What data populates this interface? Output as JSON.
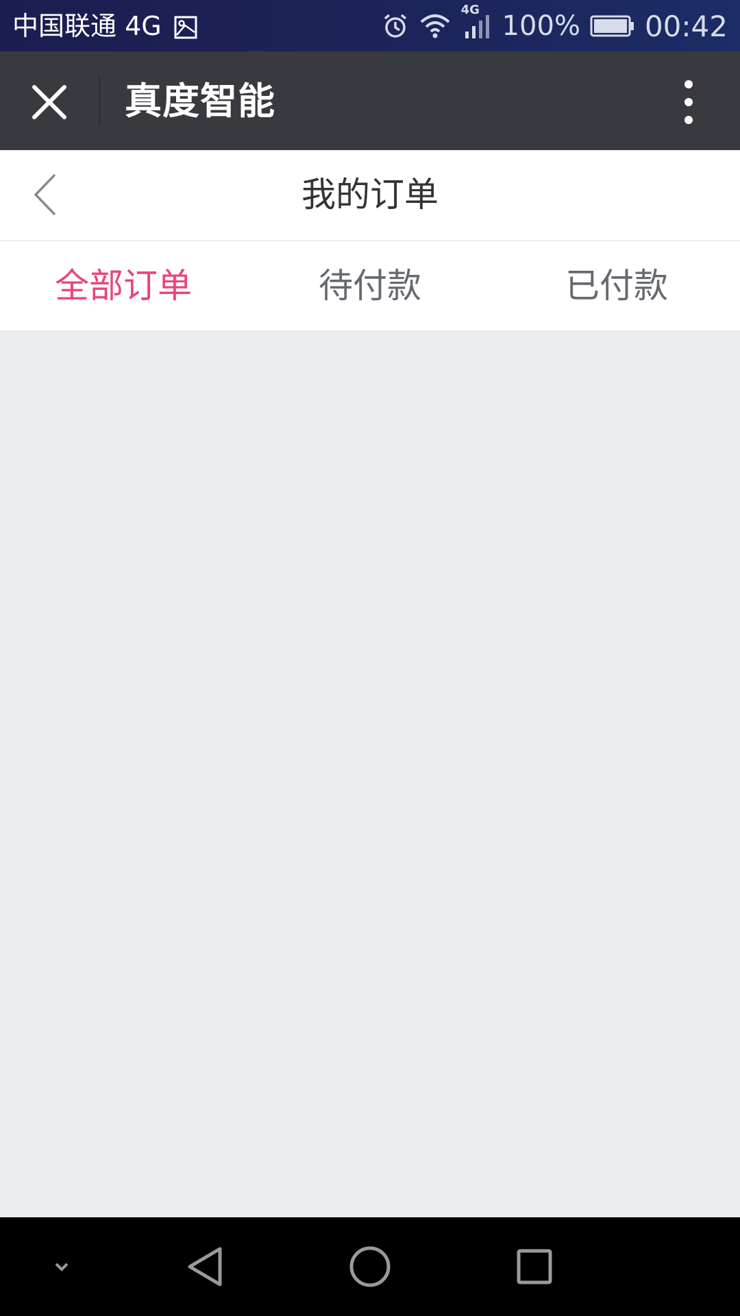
{
  "status_bar": {
    "carrier": "中国联通 4G",
    "network_badge": "4G",
    "battery": "100%",
    "time": "00:42",
    "icons": [
      "image-icon",
      "alarm-icon",
      "wifi-icon",
      "signal-icon",
      "battery-icon"
    ]
  },
  "wx_header": {
    "title": "真度智能",
    "icons": [
      "close-icon",
      "more-vertical-icon"
    ]
  },
  "page_header": {
    "title": "我的订单",
    "icons": [
      "chevron-left-icon"
    ]
  },
  "tabs": [
    {
      "label": "全部订单",
      "active": true
    },
    {
      "label": "待付款",
      "active": false
    },
    {
      "label": "已付款",
      "active": false
    }
  ],
  "nav_bar": {
    "icons": [
      "chevron-down-icon",
      "triangle-back-icon",
      "circle-home-icon",
      "square-recents-icon"
    ]
  },
  "colors": {
    "active_tab": "#e9467a",
    "inactive_tab": "#666a70",
    "wx_header_bg": "#393a3f",
    "content_bg": "#ecedf1"
  }
}
